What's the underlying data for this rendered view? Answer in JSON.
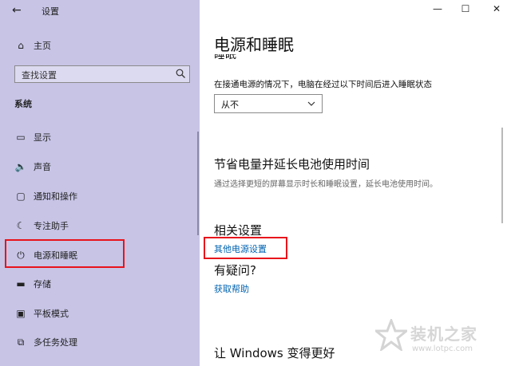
{
  "window": {
    "title": "设置",
    "controls": {
      "minimize": "—",
      "maximize": "☐",
      "close": "✕"
    }
  },
  "sidebar": {
    "home_label": "主页",
    "search_placeholder": "查找设置",
    "section_title": "系统",
    "items": [
      {
        "label": "显示",
        "icon": "monitor-icon"
      },
      {
        "label": "声音",
        "icon": "speaker-icon"
      },
      {
        "label": "通知和操作",
        "icon": "notification-icon"
      },
      {
        "label": "专注助手",
        "icon": "moon-icon"
      },
      {
        "label": "电源和睡眠",
        "icon": "power-icon",
        "selected": true
      },
      {
        "label": "存储",
        "icon": "storage-icon"
      },
      {
        "label": "平板模式",
        "icon": "tablet-icon"
      },
      {
        "label": "多任务处理",
        "icon": "multitask-icon"
      }
    ]
  },
  "main": {
    "title": "电源和睡眠",
    "cut_heading": "睡眠",
    "sleep_description": "在接通电源的情况下，电脑在经过以下时间后进入睡眠状态",
    "sleep_select_value": "从不",
    "save_heading": "节省电量并延长电池使用时间",
    "save_description": "通过选择更短的屏幕显示时长和睡眠设置，延长电池使用时间。",
    "related_heading": "相关设置",
    "power_link": "其他电源设置",
    "question_heading": "有疑问?",
    "help_link": "获取帮助",
    "better_heading": "让 Windows 变得更好"
  },
  "watermark": {
    "title": "装机之家",
    "url": "www.lotpc.com"
  },
  "colors": {
    "sidebar_bg": "#c7c4e6",
    "link": "#0063b1",
    "highlight": "#e8131b"
  }
}
